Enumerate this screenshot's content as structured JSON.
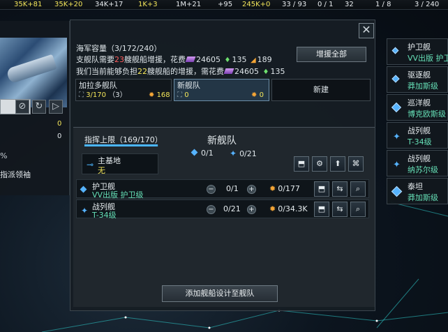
{
  "resources": [
    {
      "name": "energy",
      "text": "35K+81",
      "color": "#f4e65a"
    },
    {
      "name": "minerals",
      "text": "35K+20",
      "color": "#f4e65a"
    },
    {
      "name": "food",
      "text": "34K+17",
      "color": "#e8ecef"
    },
    {
      "name": "consumer-goods",
      "text": "1K+3",
      "color": "#f4e65a"
    },
    {
      "name": "alloys",
      "text": "1M+21",
      "color": "#e8ecef"
    },
    {
      "name": "influence",
      "text": "+95",
      "color": "#e8ecef"
    },
    {
      "name": "unity",
      "text": "245K+0",
      "color": "#f4e65a"
    },
    {
      "name": "naval-capacity",
      "text": "33 / 93",
      "color": "#e8ecef"
    },
    {
      "name": "starbases",
      "text": "0 / 1",
      "color": "#e8ecef"
    },
    {
      "name": "planets",
      "text": "32",
      "color": "#e8ecef"
    },
    {
      "name": "systems",
      "text": "1 / 8",
      "color": "#e8ecef"
    },
    {
      "name": "pops",
      "text": "3 / 240",
      "color": "#e8ecef"
    }
  ],
  "left_panel": {
    "count": "0",
    "zero": "0",
    "pct": "%",
    "leader": "指派领袖"
  },
  "notice": {
    "line0": "海军容量（3/172/240）",
    "line1_pre": "支舰队需要",
    "line1_num": "23",
    "line1_mid": "艘舰船增援，花费",
    "line1_alloy": "24605",
    "line1_energy": "135",
    "line1_influence": "189",
    "line2_pre": "我们当前能够负担",
    "line2_num": "22",
    "line2_mid": "艘舰船的增援，需花费",
    "line2_alloy": "24605",
    "line2_energy": "135"
  },
  "buttons": {
    "reinforce_all": "增援全部",
    "new": "新建",
    "add_design": "添加舰船设计至舰队",
    "close": "✕"
  },
  "fleet_tabs": [
    {
      "name": "加拉多舰队",
      "ships": "3/170",
      "extra": "（3）",
      "cost": "168"
    },
    {
      "name": "新舰队",
      "ships": "0",
      "cost": "0"
    }
  ],
  "detail": {
    "cmd_limit": "指挥上限（169/170）",
    "cmd_fraction": 0.994,
    "fleet_name": "新舰队",
    "stat_escort": "0/1",
    "stat_battleship": "0/21",
    "base_label": "主基地",
    "base_value": "无"
  },
  "designs": [
    {
      "class": "护卫舰",
      "model": "VV出版 护卫级",
      "qty": "0/1",
      "cost": "0/177"
    },
    {
      "class": "战列舰",
      "model": "T-34级",
      "qty": "0/21",
      "cost": "0/34.3K"
    }
  ],
  "right_list": [
    {
      "r1": "护卫舰",
      "r2": "VV出版 护卫"
    },
    {
      "r1": "驱逐舰",
      "r2": "莽加斯级"
    },
    {
      "r1": "巡洋舰",
      "r2": "博克欧斯级"
    },
    {
      "r1": "战列舰",
      "r2": "T-34级"
    },
    {
      "r1": "战列舰",
      "r2": "纳苏尔级"
    },
    {
      "r1": "泰坦",
      "r2": "莽加斯级"
    }
  ],
  "colors": {
    "accent_yellow": "#f4e65a",
    "accent_blue": "#56b3ff",
    "accent_green": "#66e0b7",
    "accent_orange": "#f4a536",
    "warning_red": "#ff5d5d"
  }
}
